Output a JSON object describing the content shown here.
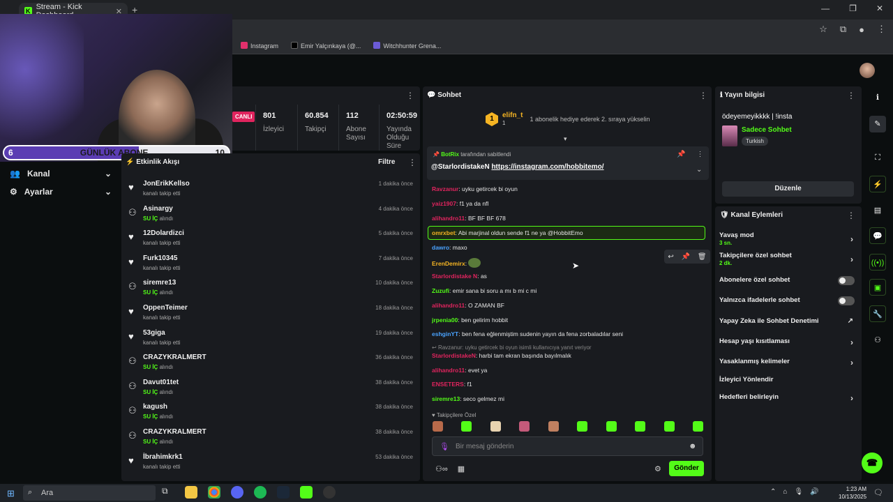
{
  "browser": {
    "tab_title": "Stream - Kick Dashboard",
    "tab_close": "✕",
    "new_tab": "+",
    "bookmarks": [
      {
        "label": "Instagram",
        "color": "#e1306c"
      },
      {
        "label": "Emir Yalçınkaya (@...",
        "color": "#000000"
      },
      {
        "label": "Witchhunter Grena...",
        "color": "#6b5bd6"
      }
    ]
  },
  "overlay": {
    "sub_goal_current": "6",
    "sub_goal_label": "GÜNLÜK ABONE",
    "sub_goal_target": "10",
    "sub_goal_progress": 0.6
  },
  "sidebar": {
    "items": [
      {
        "label": "Kanal"
      },
      {
        "label": "Ayarlar"
      }
    ]
  },
  "stats": {
    "live_badge": "CANLI",
    "items": [
      {
        "value": "801",
        "label": "İzleyici"
      },
      {
        "value": "60.854",
        "label": "Takipçi"
      },
      {
        "value": "112",
        "label": "Abone Sayısı"
      },
      {
        "value": "02:50:59",
        "label": "Yayında Olduğu Süre"
      }
    ]
  },
  "activity": {
    "title": "Etkinlik Akışı",
    "filter": "Filtre",
    "rows": [
      {
        "name": "JonErikKellso",
        "desc": "kanalı takip etti",
        "reward": "",
        "time": "1 dakika önce",
        "type": "follow"
      },
      {
        "name": "Asinargy",
        "desc": "alındı",
        "reward": "SU İÇ",
        "time": "4 dakika önce",
        "type": "reward"
      },
      {
        "name": "12Dolardizci",
        "desc": "kanalı takip etti",
        "reward": "",
        "time": "5 dakika önce",
        "type": "follow"
      },
      {
        "name": "Furk10345",
        "desc": "kanalı takip etti",
        "reward": "",
        "time": "7 dakika önce",
        "type": "follow"
      },
      {
        "name": "siremre13",
        "desc": "alındı",
        "reward": "SU İÇ",
        "time": "10 dakika önce",
        "type": "reward"
      },
      {
        "name": "OppenTeimer",
        "desc": "kanalı takip etti",
        "reward": "",
        "time": "18 dakika önce",
        "type": "follow"
      },
      {
        "name": "53giga",
        "desc": "kanalı takip etti",
        "reward": "",
        "time": "19 dakika önce",
        "type": "follow"
      },
      {
        "name": "CRAZYKRALMERT",
        "desc": "alındı",
        "reward": "SU İÇ",
        "time": "36 dakika önce",
        "type": "reward"
      },
      {
        "name": "Davut01tet",
        "desc": "alındı",
        "reward": "SU İÇ",
        "time": "38 dakika önce",
        "type": "reward"
      },
      {
        "name": "kagush",
        "desc": "alındı",
        "reward": "SU İÇ",
        "time": "38 dakika önce",
        "type": "reward"
      },
      {
        "name": "CRAZYKRALMERT",
        "desc": "alındı",
        "reward": "SU İÇ",
        "time": "38 dakika önce",
        "type": "reward"
      },
      {
        "name": "İbrahimkrk1",
        "desc": "kanalı takip etti",
        "reward": "",
        "time": "53 dakika önce",
        "type": "follow"
      }
    ]
  },
  "chat": {
    "title": "Sohbet",
    "gift": {
      "badge": "1",
      "user": "elifn_t",
      "count": "1",
      "text": "1 abonelik hediye ederek 2. sıraya yükselin"
    },
    "pinned": {
      "by_user": "BotRix",
      "by_text": "tarafından sabitlendi",
      "mention": "@StarlordistakeN",
      "link": "https://instagram.com/hobbitemo/"
    },
    "messages": [
      {
        "user": "Ravzanur",
        "text": "uyku getircek bi oyun",
        "color": "#e0245e"
      },
      {
        "user": "yaiz1907",
        "text": "f1 ya da nfl",
        "color": "#e0245e"
      },
      {
        "user": "alihandro11",
        "text": "BF BF BF 678",
        "color": "#e0245e"
      },
      {
        "user": "omrxbet",
        "text": "Abi marjinal oldun sende f1 ne ya @HobbitEmo",
        "color": "#f5b423"
      },
      {
        "user": "dawro",
        "text": "maxo",
        "color": "#4aa3ff"
      },
      {
        "user": "ErenDemirx",
        "text": "",
        "color": "#f5b423"
      },
      {
        "user": "Starlordistake N",
        "text": "as",
        "color": "#e0245e"
      },
      {
        "user": "Zuzufi",
        "text": "emir sana bi soru a mı b mi c mi",
        "color": "#53fc18"
      },
      {
        "user": "alihandro11",
        "text": "O ZAMAN BF",
        "color": "#e0245e"
      },
      {
        "user": "jrpenia00",
        "text": "ben gelirim hobbit",
        "color": "#53fc18"
      },
      {
        "user": "eshginYT",
        "text": "ben fena eğlenmiştim sudenin yayın da fena zorbaladılar seni",
        "color": "#4aa3ff"
      },
      {
        "user": "StarlordistakeN",
        "text": "harbi tam ekran başında bayılmalık",
        "color": "#e0245e"
      },
      {
        "user": "alihandro11",
        "text": "evet ya",
        "color": "#e0245e"
      },
      {
        "user": "ENSETERS",
        "text": "f1",
        "color": "#e0245e"
      },
      {
        "user": "siremre13",
        "text": "seco gelmez mi",
        "color": "#53fc18"
      }
    ],
    "reply_context": "Ravzanur: uyku getircek bi oyun isimli kullanıcıya yanıt veriyor",
    "emote_label": "Takipçilere Özel",
    "input_placeholder": "Bir mesaj gönderin",
    "send": "Gönder"
  },
  "info": {
    "title": "Yayın bilgisi",
    "stream_title": "ödeyemeyikkkk | !insta",
    "category": "Sadece Sohbet",
    "language": "Turkish",
    "edit": "Düzenle"
  },
  "channel_actions": {
    "title": "Kanal Eylemleri",
    "items": [
      {
        "label": "Yavaş mod",
        "sub": "3 sn.",
        "control": "chevron"
      },
      {
        "label": "Takipçilere özel sohbet",
        "sub": "2 dk.",
        "control": "chevron"
      },
      {
        "label": "Abonelere özel sohbet",
        "sub": "",
        "control": "toggle"
      },
      {
        "label": "Yalnızca ifadelerle sohbet",
        "sub": "",
        "control": "toggle"
      },
      {
        "label": "Yapay Zeka ile Sohbet Denetimi",
        "sub": "",
        "control": "external"
      },
      {
        "label": "Hesap yaşı kısıtlaması",
        "sub": "",
        "control": "chevron"
      },
      {
        "label": "Yasaklanmış kelimeler",
        "sub": "",
        "control": "chevron"
      },
      {
        "label": "İzleyici Yönlendir",
        "sub": "",
        "control": "none"
      },
      {
        "label": "Hedefleri belirleyin",
        "sub": "",
        "control": "chevron"
      }
    ]
  },
  "taskbar": {
    "search": "Ara",
    "time": "1:23 AM",
    "date": "10/13/2025"
  },
  "colors": {
    "accent": "#53fc18",
    "live": "#e0245e",
    "sub_bar": "#5b3db3"
  }
}
